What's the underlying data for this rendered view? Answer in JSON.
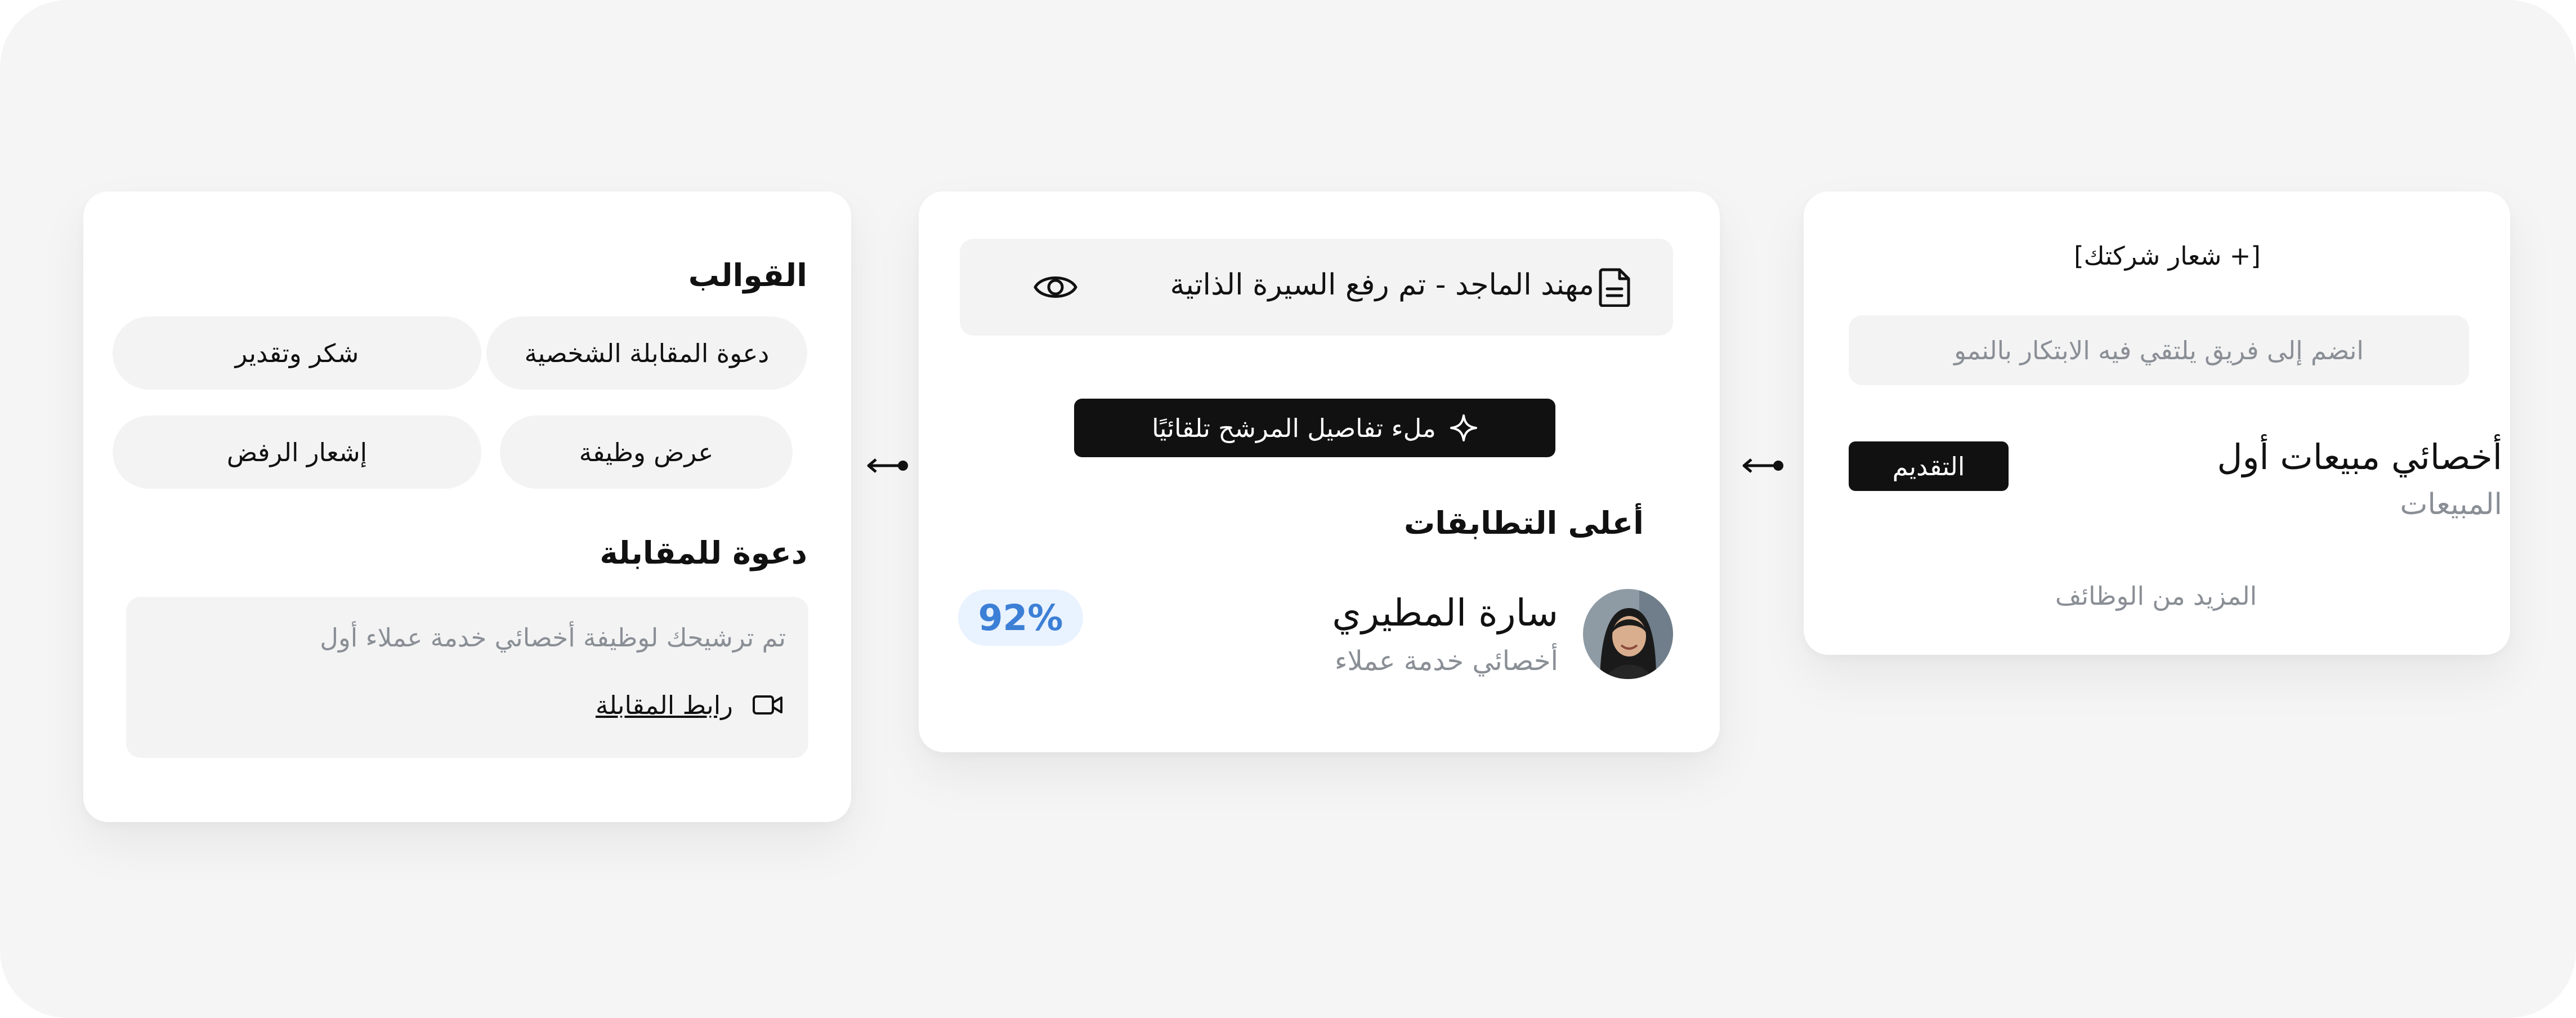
{
  "jobs_card": {
    "logo_placeholder": "[+ شعار شركتك]",
    "tagline": "انضم إلى فريق يلتقي فيه الابتكار بالنمو",
    "job_title": "أخصائي مبيعات أول",
    "job_department": "المبيعات",
    "apply_label": "التقديم",
    "more_jobs_label": "المزيد من الوظائف"
  },
  "candidates_card": {
    "file_status": "مهند الماجد - تم رفع السيرة الذاتية",
    "autofill_label": "ملء تفاصيل المرشح تلقائيًا",
    "top_matches_title": "أعلى التطابقات",
    "candidate": {
      "name": "سارة المطيري",
      "role": "أخصائي خدمة عملاء",
      "match_score": "92%"
    }
  },
  "templates_card": {
    "title": "القوالب",
    "chips": [
      "دعوة المقابلة الشخصية",
      "شكر وتقدير",
      "عرض وظيفة",
      "إشعار الرفض"
    ],
    "invite_title": "دعوة للمقابلة",
    "invite_text": "تم ترشيحك لوظيفة أخصائي خدمة عملاء أول",
    "invite_link_label": "رابط المقابلة"
  },
  "colors": {
    "background": "#f5f5f5",
    "card": "#ffffff",
    "primary_button": "#111111",
    "muted_text": "#8a8f96",
    "score_badge_bg": "#e9f2ff",
    "score_badge_text": "#3c7fd6"
  },
  "icons": {
    "file": "document-icon",
    "view": "eye-icon",
    "sparkle": "sparkle-icon",
    "video": "video-camera-icon",
    "arrow": "arrow-left-connector-icon"
  }
}
